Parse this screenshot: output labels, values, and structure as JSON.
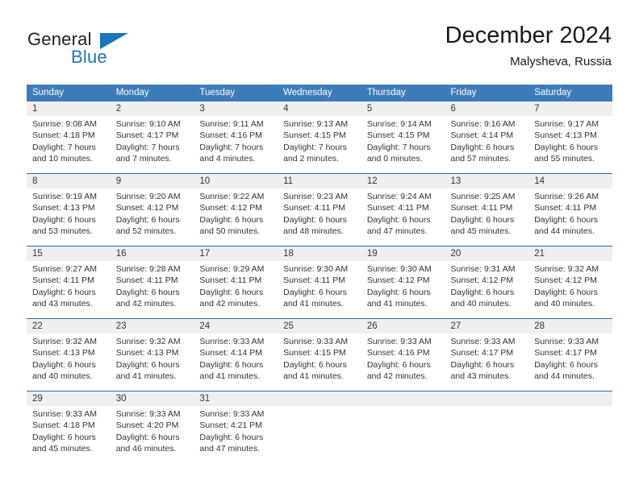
{
  "brand": {
    "name_part1": "General",
    "name_part2": "Blue"
  },
  "header": {
    "title": "December 2024",
    "subtitle": "Malysheva, Russia"
  },
  "colors": {
    "header_blue": "#3b7cb8",
    "row_divider_blue": "#2b6ca8",
    "daynum_band": "#efefef",
    "brand_blue": "#1b75bb"
  },
  "calendar": {
    "weekdays": [
      "Sunday",
      "Monday",
      "Tuesday",
      "Wednesday",
      "Thursday",
      "Friday",
      "Saturday"
    ],
    "weeks": [
      [
        {
          "day": "1",
          "sunrise": "Sunrise: 9:08 AM",
          "sunset": "Sunset: 4:18 PM",
          "daylight_line1": "Daylight: 7 hours",
          "daylight_line2": "and 10 minutes."
        },
        {
          "day": "2",
          "sunrise": "Sunrise: 9:10 AM",
          "sunset": "Sunset: 4:17 PM",
          "daylight_line1": "Daylight: 7 hours",
          "daylight_line2": "and 7 minutes."
        },
        {
          "day": "3",
          "sunrise": "Sunrise: 9:11 AM",
          "sunset": "Sunset: 4:16 PM",
          "daylight_line1": "Daylight: 7 hours",
          "daylight_line2": "and 4 minutes."
        },
        {
          "day": "4",
          "sunrise": "Sunrise: 9:13 AM",
          "sunset": "Sunset: 4:15 PM",
          "daylight_line1": "Daylight: 7 hours",
          "daylight_line2": "and 2 minutes."
        },
        {
          "day": "5",
          "sunrise": "Sunrise: 9:14 AM",
          "sunset": "Sunset: 4:15 PM",
          "daylight_line1": "Daylight: 7 hours",
          "daylight_line2": "and 0 minutes."
        },
        {
          "day": "6",
          "sunrise": "Sunrise: 9:16 AM",
          "sunset": "Sunset: 4:14 PM",
          "daylight_line1": "Daylight: 6 hours",
          "daylight_line2": "and 57 minutes."
        },
        {
          "day": "7",
          "sunrise": "Sunrise: 9:17 AM",
          "sunset": "Sunset: 4:13 PM",
          "daylight_line1": "Daylight: 6 hours",
          "daylight_line2": "and 55 minutes."
        }
      ],
      [
        {
          "day": "8",
          "sunrise": "Sunrise: 9:19 AM",
          "sunset": "Sunset: 4:13 PM",
          "daylight_line1": "Daylight: 6 hours",
          "daylight_line2": "and 53 minutes."
        },
        {
          "day": "9",
          "sunrise": "Sunrise: 9:20 AM",
          "sunset": "Sunset: 4:12 PM",
          "daylight_line1": "Daylight: 6 hours",
          "daylight_line2": "and 52 minutes."
        },
        {
          "day": "10",
          "sunrise": "Sunrise: 9:22 AM",
          "sunset": "Sunset: 4:12 PM",
          "daylight_line1": "Daylight: 6 hours",
          "daylight_line2": "and 50 minutes."
        },
        {
          "day": "11",
          "sunrise": "Sunrise: 9:23 AM",
          "sunset": "Sunset: 4:11 PM",
          "daylight_line1": "Daylight: 6 hours",
          "daylight_line2": "and 48 minutes."
        },
        {
          "day": "12",
          "sunrise": "Sunrise: 9:24 AM",
          "sunset": "Sunset: 4:11 PM",
          "daylight_line1": "Daylight: 6 hours",
          "daylight_line2": "and 47 minutes."
        },
        {
          "day": "13",
          "sunrise": "Sunrise: 9:25 AM",
          "sunset": "Sunset: 4:11 PM",
          "daylight_line1": "Daylight: 6 hours",
          "daylight_line2": "and 45 minutes."
        },
        {
          "day": "14",
          "sunrise": "Sunrise: 9:26 AM",
          "sunset": "Sunset: 4:11 PM",
          "daylight_line1": "Daylight: 6 hours",
          "daylight_line2": "and 44 minutes."
        }
      ],
      [
        {
          "day": "15",
          "sunrise": "Sunrise: 9:27 AM",
          "sunset": "Sunset: 4:11 PM",
          "daylight_line1": "Daylight: 6 hours",
          "daylight_line2": "and 43 minutes."
        },
        {
          "day": "16",
          "sunrise": "Sunrise: 9:28 AM",
          "sunset": "Sunset: 4:11 PM",
          "daylight_line1": "Daylight: 6 hours",
          "daylight_line2": "and 42 minutes."
        },
        {
          "day": "17",
          "sunrise": "Sunrise: 9:29 AM",
          "sunset": "Sunset: 4:11 PM",
          "daylight_line1": "Daylight: 6 hours",
          "daylight_line2": "and 42 minutes."
        },
        {
          "day": "18",
          "sunrise": "Sunrise: 9:30 AM",
          "sunset": "Sunset: 4:11 PM",
          "daylight_line1": "Daylight: 6 hours",
          "daylight_line2": "and 41 minutes."
        },
        {
          "day": "19",
          "sunrise": "Sunrise: 9:30 AM",
          "sunset": "Sunset: 4:12 PM",
          "daylight_line1": "Daylight: 6 hours",
          "daylight_line2": "and 41 minutes."
        },
        {
          "day": "20",
          "sunrise": "Sunrise: 9:31 AM",
          "sunset": "Sunset: 4:12 PM",
          "daylight_line1": "Daylight: 6 hours",
          "daylight_line2": "and 40 minutes."
        },
        {
          "day": "21",
          "sunrise": "Sunrise: 9:32 AM",
          "sunset": "Sunset: 4:12 PM",
          "daylight_line1": "Daylight: 6 hours",
          "daylight_line2": "and 40 minutes."
        }
      ],
      [
        {
          "day": "22",
          "sunrise": "Sunrise: 9:32 AM",
          "sunset": "Sunset: 4:13 PM",
          "daylight_line1": "Daylight: 6 hours",
          "daylight_line2": "and 40 minutes."
        },
        {
          "day": "23",
          "sunrise": "Sunrise: 9:32 AM",
          "sunset": "Sunset: 4:13 PM",
          "daylight_line1": "Daylight: 6 hours",
          "daylight_line2": "and 41 minutes."
        },
        {
          "day": "24",
          "sunrise": "Sunrise: 9:33 AM",
          "sunset": "Sunset: 4:14 PM",
          "daylight_line1": "Daylight: 6 hours",
          "daylight_line2": "and 41 minutes."
        },
        {
          "day": "25",
          "sunrise": "Sunrise: 9:33 AM",
          "sunset": "Sunset: 4:15 PM",
          "daylight_line1": "Daylight: 6 hours",
          "daylight_line2": "and 41 minutes."
        },
        {
          "day": "26",
          "sunrise": "Sunrise: 9:33 AM",
          "sunset": "Sunset: 4:16 PM",
          "daylight_line1": "Daylight: 6 hours",
          "daylight_line2": "and 42 minutes."
        },
        {
          "day": "27",
          "sunrise": "Sunrise: 9:33 AM",
          "sunset": "Sunset: 4:17 PM",
          "daylight_line1": "Daylight: 6 hours",
          "daylight_line2": "and 43 minutes."
        },
        {
          "day": "28",
          "sunrise": "Sunrise: 9:33 AM",
          "sunset": "Sunset: 4:17 PM",
          "daylight_line1": "Daylight: 6 hours",
          "daylight_line2": "and 44 minutes."
        }
      ],
      [
        {
          "day": "29",
          "sunrise": "Sunrise: 9:33 AM",
          "sunset": "Sunset: 4:18 PM",
          "daylight_line1": "Daylight: 6 hours",
          "daylight_line2": "and 45 minutes."
        },
        {
          "day": "30",
          "sunrise": "Sunrise: 9:33 AM",
          "sunset": "Sunset: 4:20 PM",
          "daylight_line1": "Daylight: 6 hours",
          "daylight_line2": "and 46 minutes."
        },
        {
          "day": "31",
          "sunrise": "Sunrise: 9:33 AM",
          "sunset": "Sunset: 4:21 PM",
          "daylight_line1": "Daylight: 6 hours",
          "daylight_line2": "and 47 minutes."
        },
        {
          "day": "",
          "sunrise": "",
          "sunset": "",
          "daylight_line1": "",
          "daylight_line2": ""
        },
        {
          "day": "",
          "sunrise": "",
          "sunset": "",
          "daylight_line1": "",
          "daylight_line2": ""
        },
        {
          "day": "",
          "sunrise": "",
          "sunset": "",
          "daylight_line1": "",
          "daylight_line2": ""
        },
        {
          "day": "",
          "sunrise": "",
          "sunset": "",
          "daylight_line1": "",
          "daylight_line2": ""
        }
      ]
    ]
  }
}
